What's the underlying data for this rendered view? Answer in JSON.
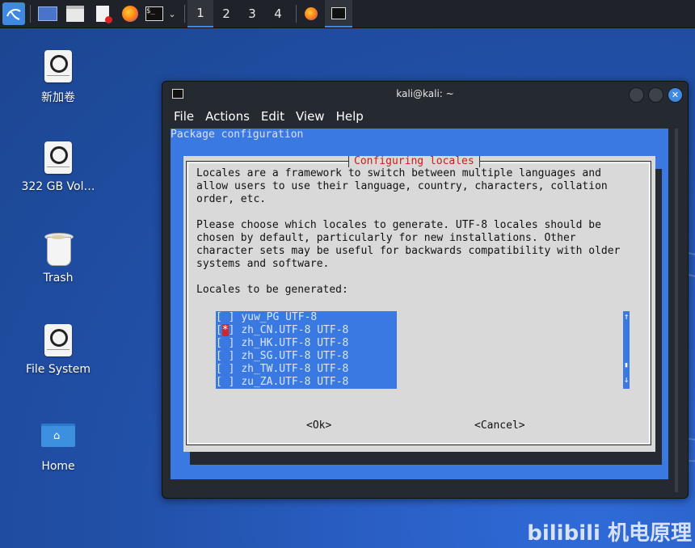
{
  "taskbar": {
    "icons": [
      "kali-menu-icon",
      "desktop-icon",
      "files-icon",
      "text-editor-icon",
      "firefox-icon",
      "terminal-icon",
      "chevron-down-icon",
      "firefox-task-icon",
      "terminal-task-icon"
    ],
    "workspaces": [
      "1",
      "2",
      "3",
      "4"
    ],
    "active_workspace": 0
  },
  "desktop": {
    "items": [
      {
        "label": "新加卷",
        "icon": "drive-icon"
      },
      {
        "label": "322 GB Vol…",
        "icon": "drive-icon"
      },
      {
        "label": "Trash",
        "icon": "trash-icon"
      },
      {
        "label": "File System",
        "icon": "drive-icon"
      },
      {
        "label": "Home",
        "icon": "home-folder-icon"
      }
    ]
  },
  "window": {
    "title": "kali@kali: ~",
    "menu": [
      "File",
      "Actions",
      "Edit",
      "View",
      "Help"
    ]
  },
  "terminal": {
    "header": "Package configuration",
    "dialog_title": "Configuring locales",
    "para1": [
      "Locales are a framework to switch between multiple languages and",
      "allow users to use their language, country, characters, collation",
      "order, etc."
    ],
    "para2": [
      "Please choose which locales to generate. UTF-8 locales should be",
      "chosen by default, particularly for new installations. Other",
      "character sets may be useful for backwards compatibility with older",
      "systems and software."
    ],
    "list_label": "Locales to be generated:",
    "locales": [
      {
        "checked": false,
        "name": "yuw_PG UTF-8"
      },
      {
        "checked": true,
        "name": "zh_CN.UTF-8 UTF-8"
      },
      {
        "checked": false,
        "name": "zh_HK.UTF-8 UTF-8"
      },
      {
        "checked": false,
        "name": "zh_SG.UTF-8 UTF-8"
      },
      {
        "checked": false,
        "name": "zh_TW.UTF-8 UTF-8"
      },
      {
        "checked": false,
        "name": "zu_ZA.UTF-8 UTF-8"
      }
    ],
    "scroll_up": "↑",
    "scroll_thumb": "▮",
    "scroll_down": "↓",
    "ok": "<Ok>",
    "cancel": "<Cancel>"
  },
  "watermark": "bilibili 机电原理",
  "colors": {
    "accent": "#3f8ae0",
    "dialog_blue": "#3b79e2",
    "dialog_bg": "#d9d9d9",
    "title_red": "#c81e1e"
  }
}
